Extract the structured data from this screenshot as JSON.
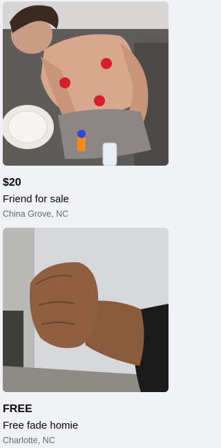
{
  "listings": [
    {
      "price": "$20",
      "title": "Friend for sale",
      "location": "China Grove, NC",
      "image_icon": "photo-person-sleeping-on-couch"
    },
    {
      "price": "FREE",
      "title": "Free fade homie",
      "location": "Charlotte, NC",
      "image_icon": "photo-raised-fist"
    }
  ]
}
